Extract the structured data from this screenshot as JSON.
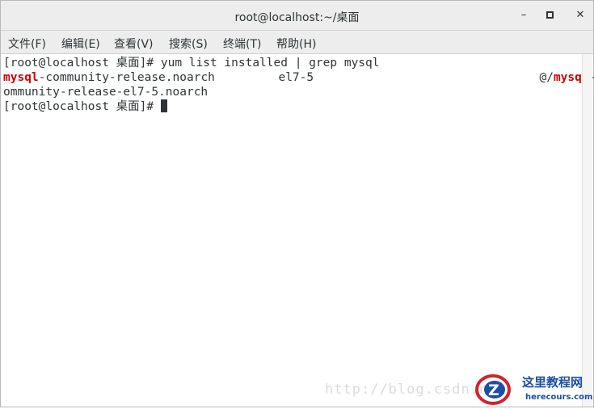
{
  "window": {
    "title": "root@localhost:~/桌面"
  },
  "controls": {
    "minimize": "–",
    "maximize": "▫",
    "close": "✕"
  },
  "menu": [
    "文件(F)",
    "编辑(E)",
    "查看(V)",
    "搜索(S)",
    "终端(T)",
    "帮助(H)"
  ],
  "terminal": {
    "line1": "[root@localhost 桌面]# yum list installed | grep mysql",
    "line2_a": "mysql",
    "line2_b": "-community-release.noarch         el7-5                                @/",
    "line2_c": "mysql",
    "line2_d": "-c",
    "line3": "ommunity-release-el7-5.noarch",
    "line4": "[root@localhost 桌面]# "
  },
  "watermark": {
    "url": "http://blog.csdn.ne",
    "logo_title": "这里教程网",
    "logo_sub": "herecours.com",
    "logo_letter": "Z"
  }
}
